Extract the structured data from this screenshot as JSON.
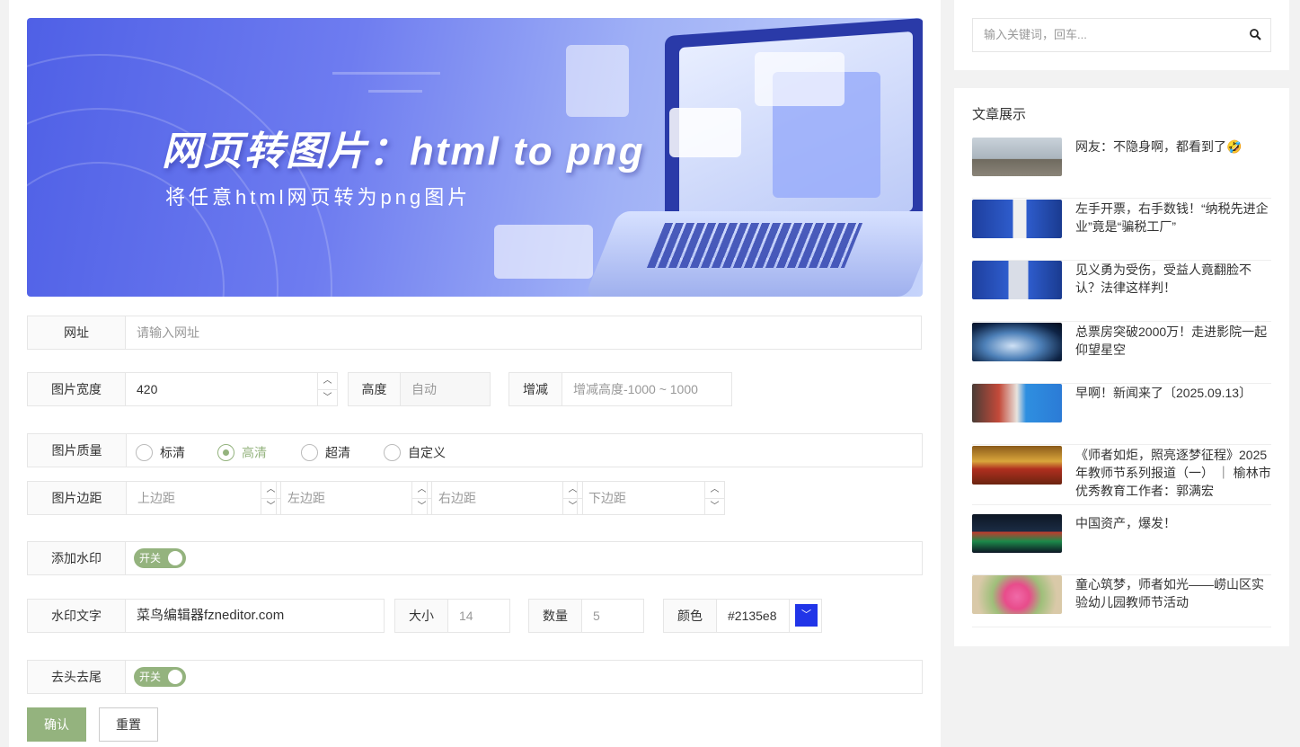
{
  "banner": {
    "title": "网页转图片：html to png",
    "subtitle": "将任意html网页转为png图片"
  },
  "form": {
    "url": {
      "label": "网址",
      "placeholder": "请输入网址"
    },
    "width": {
      "label": "图片宽度",
      "value": "420"
    },
    "height": {
      "label": "高度",
      "placeholder": "自动"
    },
    "adjust": {
      "label": "增减",
      "placeholder": "增减高度-1000 ~ 1000"
    },
    "quality": {
      "label": "图片质量",
      "options": [
        "标清",
        "高清",
        "超清",
        "自定义"
      ],
      "selected": "高清"
    },
    "margin": {
      "label": "图片边距",
      "top": "上边距",
      "left": "左边距",
      "right": "右边距",
      "bottom": "下边距"
    },
    "watermark": {
      "label": "添加水印",
      "toggle": "开关",
      "on": true
    },
    "watermark_text": {
      "label": "水印文字",
      "value": "菜鸟编辑器fzneditor.com",
      "size_label": "大小",
      "size_placeholder": "14",
      "count_label": "数量",
      "count_placeholder": "5",
      "color_label": "颜色",
      "color_value": "#2135e8"
    },
    "trim": {
      "label": "去头去尾",
      "toggle": "开关",
      "on": true
    },
    "confirm": "确认",
    "reset": "重置"
  },
  "sidebar": {
    "search_placeholder": "输入关键词，回车...",
    "section_title": "文章展示",
    "articles": [
      {
        "title": "网友：不隐身啊，都看到了🤣"
      },
      {
        "title": "左手开票，右手数钱！“纳税先进企业”竟是“骗税工厂”"
      },
      {
        "title": "见义勇为受伤，受益人竟翻脸不认？法律这样判！"
      },
      {
        "title": "总票房突破2000万！走进影院一起仰望星空"
      },
      {
        "title": "早啊！新闻来了〔2025.09.13〕"
      },
      {
        "title": "《师者如炬，照亮逐梦征程》2025年教师节系列报道（一） ｜ 榆林市优秀教育工作者：郭满宏"
      },
      {
        "title": "中国资产，爆发！"
      },
      {
        "title": "童心筑梦，师者如光——崂山区实验幼儿园教师节活动"
      }
    ]
  },
  "colors": {
    "accent": "#94b37e",
    "watermark": "#2135e8"
  }
}
